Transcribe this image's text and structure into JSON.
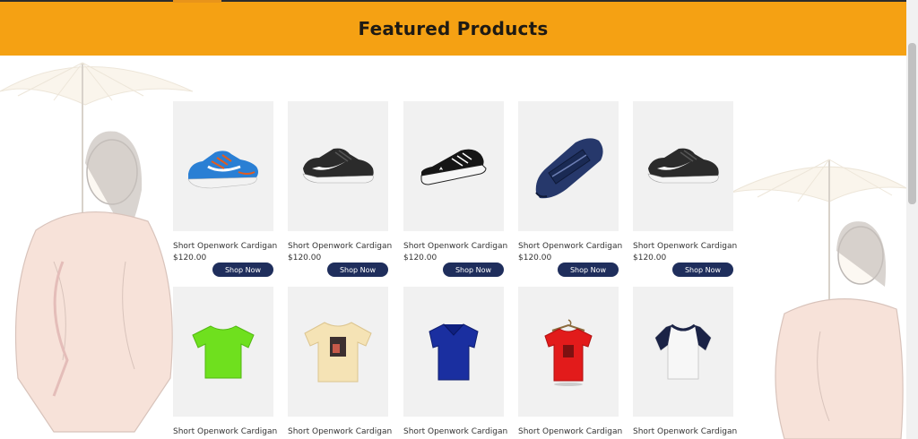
{
  "header": {
    "title": "Featured Products",
    "color": "#f5a113"
  },
  "button_color": "#1f2e5c",
  "products": [
    {
      "name": "Short Openwork Cardigan",
      "price": "$120.00",
      "button": "Shop Now",
      "icon": "blue-running-shoe-image"
    },
    {
      "name": "Short Openwork Cardigan",
      "price": "$120.00",
      "button": "Shop Now",
      "icon": "black-nike-shoe-image"
    },
    {
      "name": "Short Openwork Cardigan",
      "price": "$120.00",
      "button": "Shop Now",
      "icon": "black-converse-sneaker-image"
    },
    {
      "name": "Short Openwork Cardigan",
      "price": "$120.00",
      "button": "Shop Now",
      "icon": "navy-loafer-image"
    },
    {
      "name": "Short Openwork Cardigan",
      "price": "$120.00",
      "button": "Shop Now",
      "icon": "black-nike-shoe-image"
    },
    {
      "name": "Short Openwork Cardigan",
      "icon": "green-tshirt-image"
    },
    {
      "name": "Short Openwork Cardigan",
      "icon": "cream-graphic-tshirt-image"
    },
    {
      "name": "Short Openwork Cardigan",
      "icon": "blue-polo-shirt-image"
    },
    {
      "name": "Short Openwork Cardigan",
      "icon": "red-tshirt-on-hanger-image"
    },
    {
      "name": "Short Openwork Cardigan",
      "icon": "white-navy-raglan-tshirt-image"
    }
  ]
}
